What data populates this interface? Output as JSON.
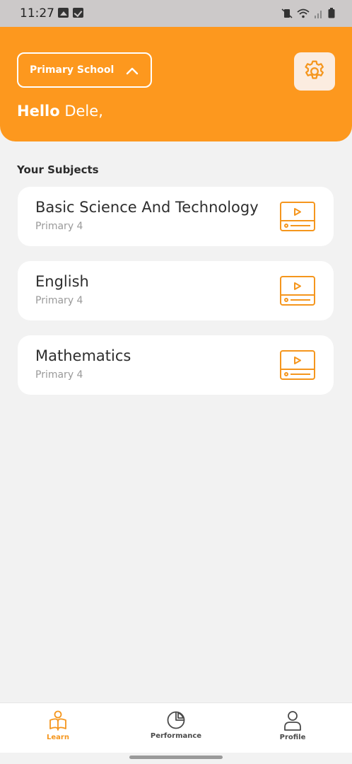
{
  "status_bar": {
    "time": "11:27",
    "icons_left": [
      "gallery-icon",
      "checkbox-icon"
    ],
    "icons_right": [
      "mute-vibrate-icon",
      "wifi-icon",
      "signal-icon",
      "battery-icon"
    ]
  },
  "header": {
    "level_select": {
      "value": "Primary School",
      "expanded": true
    },
    "greeting": {
      "hello": "Hello",
      "name": "Dele,"
    },
    "settings_icon": "gear-icon"
  },
  "colors": {
    "accent": "#fd981e",
    "icon_orange": "#f5961d",
    "background": "#f2f2f2",
    "card": "#ffffff"
  },
  "section": {
    "title": "Your Subjects"
  },
  "subjects": [
    {
      "name": "Basic Science And Technology",
      "level": "Primary 4",
      "icon": "video-player-icon"
    },
    {
      "name": "English",
      "level": "Primary 4",
      "icon": "video-player-icon"
    },
    {
      "name": "Mathematics",
      "level": "Primary 4",
      "icon": "video-player-icon"
    }
  ],
  "bottom_nav": {
    "items": [
      {
        "label": "Learn",
        "icon": "reading-person-icon",
        "active": true
      },
      {
        "label": "Performance",
        "icon": "pie-chart-icon",
        "active": false
      },
      {
        "label": "Profile",
        "icon": "user-icon",
        "active": false
      }
    ]
  }
}
